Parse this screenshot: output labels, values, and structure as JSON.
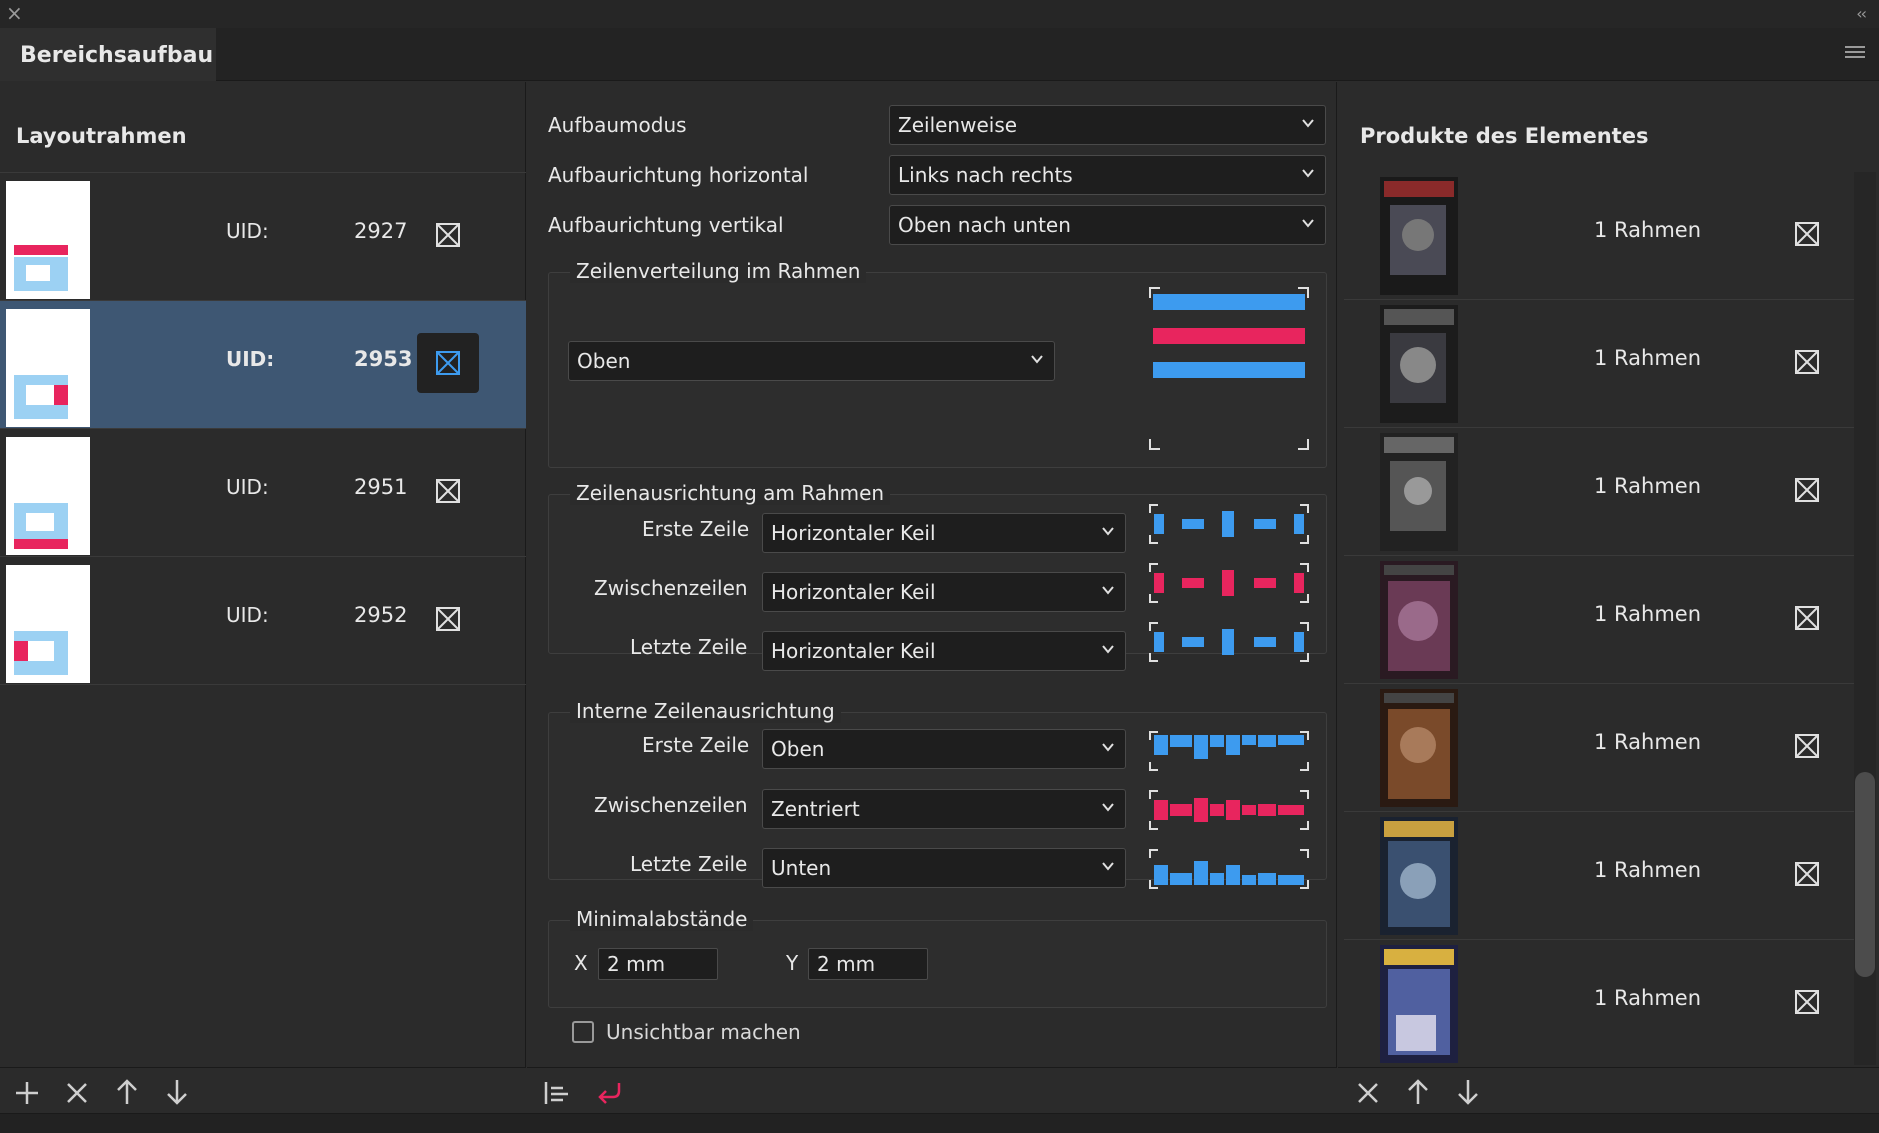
{
  "window": {
    "close_glyph": "×",
    "collapse_glyph": "‹‹",
    "tab_title": "Bereichsaufbau"
  },
  "left_panel": {
    "title": "Layoutrahmen",
    "rows": [
      {
        "uid_label": "UID:",
        "uid": "2927",
        "selected": false
      },
      {
        "uid_label": "UID:",
        "uid": "2953",
        "selected": true
      },
      {
        "uid_label": "UID:",
        "uid": "2951",
        "selected": false
      },
      {
        "uid_label": "UID:",
        "uid": "2952",
        "selected": false
      }
    ],
    "toolbar": [
      "add-icon",
      "delete-icon",
      "move-up-icon",
      "move-down-icon"
    ]
  },
  "middle_panel": {
    "aufbaumodus": {
      "label": "Aufbaumodus",
      "value": "Zeilenweise"
    },
    "horizontal": {
      "label": "Aufbaurichtung horizontal",
      "value": "Links nach rechts"
    },
    "vertikal": {
      "label": "Aufbaurichtung vertikal",
      "value": "Oben nach unten"
    },
    "verteilung": {
      "title": "Zeilenverteilung im Rahmen",
      "value": "Oben"
    },
    "ausrichtung": {
      "title": "Zeilenausrichtung am Rahmen",
      "erste": {
        "label": "Erste Zeile",
        "value": "Horizontaler Keil"
      },
      "zwischen": {
        "label": "Zwischenzeilen",
        "value": "Horizontaler Keil"
      },
      "letzte": {
        "label": "Letzte Zeile",
        "value": "Horizontaler Keil"
      }
    },
    "intern": {
      "title": "Interne Zeilenausrichtung",
      "erste": {
        "label": "Erste Zeile",
        "value": "Oben"
      },
      "zwischen": {
        "label": "Zwischenzeilen",
        "value": "Zentriert"
      },
      "letzte": {
        "label": "Letzte Zeile",
        "value": "Unten"
      }
    },
    "abstaende": {
      "title": "Minimalabstände",
      "x_label": "X",
      "x_value": "2 mm",
      "y_label": "Y",
      "y_value": "2 mm"
    },
    "unsichtbar": {
      "label": "Unsichtbar machen",
      "checked": false
    },
    "toolbar": [
      "align-icon",
      "undo-icon"
    ]
  },
  "right_panel": {
    "title": "Produkte des Elementes",
    "rows": [
      {
        "label": "1 Rahmen"
      },
      {
        "label": "1 Rahmen"
      },
      {
        "label": "1 Rahmen"
      },
      {
        "label": "1 Rahmen"
      },
      {
        "label": "1 Rahmen"
      },
      {
        "label": "1 Rahmen"
      },
      {
        "label": "1 Rahmen"
      }
    ],
    "toolbar": [
      "delete-icon",
      "move-up-icon",
      "move-down-icon"
    ]
  },
  "colors": {
    "blue": "#3d9bef",
    "pink": "#e8255e",
    "light_blue": "#9cd1f3",
    "selection": "#3e5773"
  }
}
